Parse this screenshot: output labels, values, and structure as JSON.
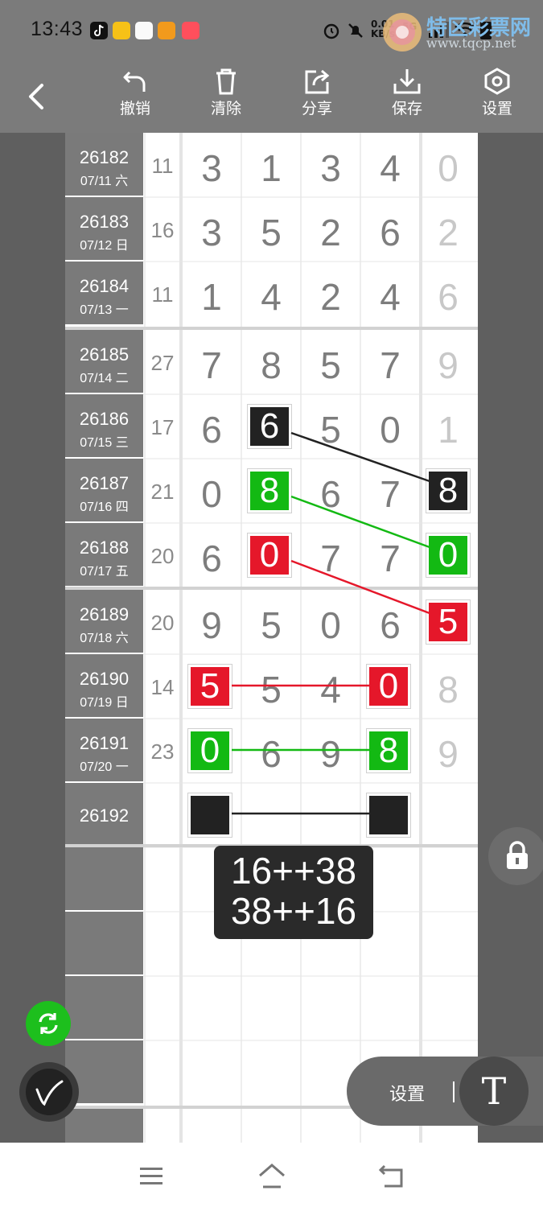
{
  "status_bar": {
    "time": "13:43",
    "speed_value": "0.01",
    "speed_unit": "KB/s",
    "network": "5G",
    "icons": [
      "tiktok-icon",
      "app-icon-yellow",
      "app-icon-avatar",
      "app-icon-video",
      "app-icon-red",
      "alarm-icon",
      "mute-icon",
      "signal-icon",
      "wifi-icon",
      "battery-icon"
    ]
  },
  "watermark": {
    "title": "特区彩票网",
    "url": "www.tqcp.net"
  },
  "toolbar": {
    "back_icon": "back-chevron-icon",
    "items": [
      {
        "label": "撤销",
        "icon": "undo-icon"
      },
      {
        "label": "清除",
        "icon": "trash-icon"
      },
      {
        "label": "分享",
        "icon": "share-icon"
      },
      {
        "label": "保存",
        "icon": "download-icon"
      },
      {
        "label": "设置",
        "icon": "hexagon-settings-icon"
      }
    ]
  },
  "rows": [
    {
      "period": "26182",
      "date": "07/11 六",
      "sum": "11",
      "digits": [
        "3",
        "1",
        "3",
        "4"
      ],
      "last": "0"
    },
    {
      "period": "26183",
      "date": "07/12 日",
      "sum": "16",
      "digits": [
        "3",
        "5",
        "2",
        "6"
      ],
      "last": "2"
    },
    {
      "period": "26184",
      "date": "07/13 一",
      "sum": "11",
      "digits": [
        "1",
        "4",
        "2",
        "4"
      ],
      "last": "6"
    },
    {
      "period": "26185",
      "date": "07/14 二",
      "sum": "27",
      "digits": [
        "7",
        "8",
        "5",
        "7"
      ],
      "last": "9"
    },
    {
      "period": "26186",
      "date": "07/15 三",
      "sum": "17",
      "digits": [
        "6",
        "6",
        "5",
        "0"
      ],
      "last": "1"
    },
    {
      "period": "26187",
      "date": "07/16 四",
      "sum": "21",
      "digits": [
        "0",
        "8",
        "6",
        "7"
      ],
      "last": "8"
    },
    {
      "period": "26188",
      "date": "07/17 五",
      "sum": "20",
      "digits": [
        "6",
        "0",
        "7",
        "7"
      ],
      "last": "0"
    },
    {
      "period": "26189",
      "date": "07/18 六",
      "sum": "20",
      "digits": [
        "9",
        "5",
        "0",
        "6"
      ],
      "last": "5"
    },
    {
      "period": "26190",
      "date": "07/19 日",
      "sum": "14",
      "digits": [
        "5",
        "5",
        "4",
        "0"
      ],
      "last": "8"
    },
    {
      "period": "26191",
      "date": "07/20 一",
      "sum": "23",
      "digits": [
        "0",
        "6",
        "9",
        "8"
      ],
      "last": "9"
    },
    {
      "period": "26192",
      "date": "",
      "sum": "",
      "digits": [
        "",
        "",
        "",
        ""
      ],
      "last": ""
    }
  ],
  "highlights": {
    "black": "#222222",
    "green": "#13b913",
    "red": "#e5172a"
  },
  "tooltip": {
    "line1": "16++38",
    "line2": "38++16"
  },
  "bottom_controls": {
    "lock_icon": "lock-icon",
    "refresh_icon": "refresh-icon",
    "pen_icon": "pen-icon",
    "settings_label": "设置",
    "text_tool_label": "T"
  },
  "nav": {
    "icons": [
      "menu-icon",
      "home-icon",
      "back-icon"
    ]
  }
}
